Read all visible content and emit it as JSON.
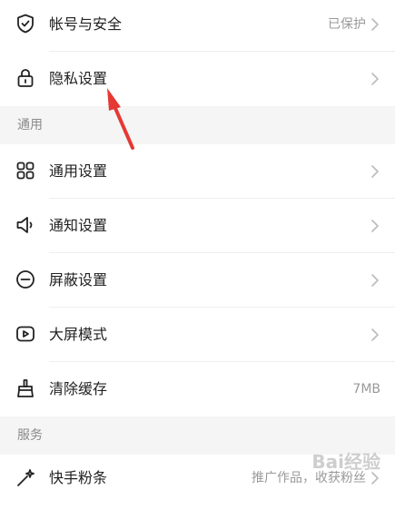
{
  "rows": {
    "account": {
      "label": "帐号与安全",
      "value": "已保护",
      "icon": "shield-check-icon"
    },
    "privacy": {
      "label": "隐私设置",
      "icon": "lock-icon"
    },
    "general": {
      "label": "通用设置",
      "icon": "grid-icon"
    },
    "notify": {
      "label": "通知设置",
      "icon": "speaker-icon"
    },
    "block": {
      "label": "屏蔽设置",
      "icon": "minus-circle-icon"
    },
    "bigscreen": {
      "label": "大屏模式",
      "icon": "play-icon"
    },
    "cache": {
      "label": "清除缓存",
      "value": "7MB",
      "icon": "broom-icon"
    },
    "fans": {
      "label": "快手粉条",
      "value": "推广作品，收获粉丝",
      "icon": "sparkle-icon"
    }
  },
  "sections": {
    "general": "通用",
    "service": "服务"
  },
  "annotation": {
    "color": "#e53935"
  },
  "watermark": {
    "text": "Bai经验"
  }
}
